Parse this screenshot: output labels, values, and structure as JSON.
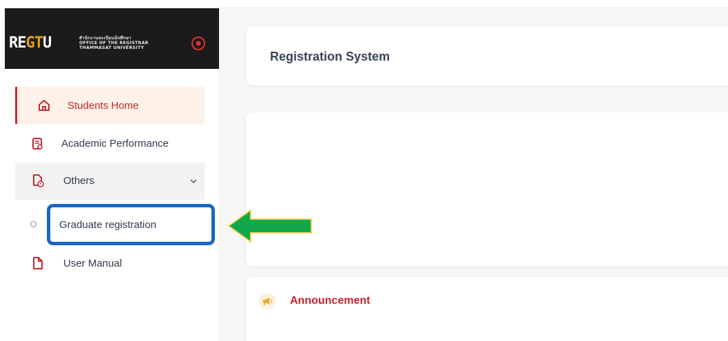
{
  "app": {
    "logo_wordmark": "REGTU",
    "logo_line1": "สำนักงานทะเบียนนักศึกษา",
    "logo_line2": "OFFICE OF THE REGISTRAR",
    "logo_line3": "THAMMASAT UNIVERSITY"
  },
  "sidebar": {
    "items": [
      {
        "label": "Students Home",
        "icon": "home-icon",
        "active": true
      },
      {
        "label": "Academic Performance",
        "icon": "document-badge-icon",
        "active": false
      },
      {
        "label": "Others",
        "icon": "document-info-icon",
        "expanded": true
      },
      {
        "label": "Graduate registration",
        "icon": "circle-bullet-icon",
        "highlighted": true
      },
      {
        "label": "User Manual",
        "icon": "file-icon",
        "active": false
      }
    ]
  },
  "main": {
    "title": "Registration System",
    "announcement": "Announcement"
  },
  "colors": {
    "accent_red": "#c4272e",
    "highlight_blue": "#1967c4",
    "arrow_green": "#10a84a",
    "arrow_outline": "#f2d35a"
  }
}
